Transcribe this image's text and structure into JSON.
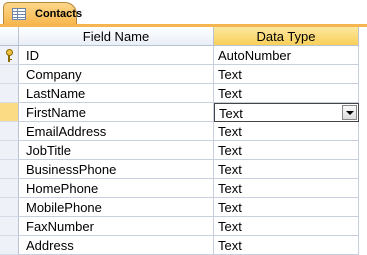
{
  "tab": {
    "label": "Contacts",
    "icon": "table-icon"
  },
  "columns": {
    "field_name": "Field Name",
    "data_type": "Data Type"
  },
  "rows": [
    {
      "field": "ID",
      "type": "AutoNumber",
      "primary_key": true
    },
    {
      "field": "Company",
      "type": "Text"
    },
    {
      "field": "LastName",
      "type": "Text"
    },
    {
      "field": "FirstName",
      "type": "Text",
      "current": true
    },
    {
      "field": "EmailAddress",
      "type": "Text"
    },
    {
      "field": "JobTitle",
      "type": "Text"
    },
    {
      "field": "BusinessPhone",
      "type": "Text"
    },
    {
      "field": "HomePhone",
      "type": "Text"
    },
    {
      "field": "MobilePhone",
      "type": "Text"
    },
    {
      "field": "FaxNumber",
      "type": "Text"
    },
    {
      "field": "Address",
      "type": "Text"
    }
  ],
  "colors": {
    "tab": "#f7b54a",
    "selected_row": "#fbdc85",
    "grid_line": "#c8d0dd"
  }
}
